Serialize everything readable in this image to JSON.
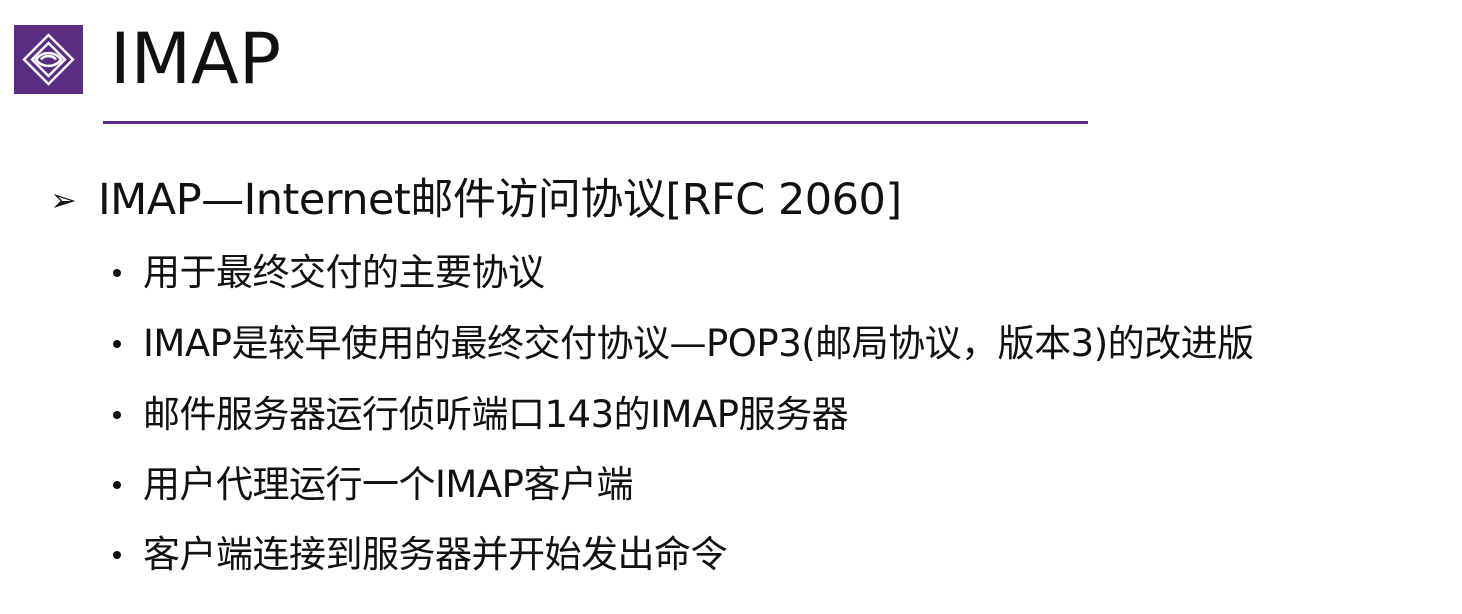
{
  "slide": {
    "title": "IMAP",
    "icon": "purple-emblem-icon",
    "accent_color": "#5b2d82",
    "main_bullet": "IMAP—Internet邮件访问协议[RFC 2060]",
    "sub_bullets": [
      "用于最终交付的主要协议",
      "IMAP是较早使用的最终交付协议—POP3(邮局协议，版本3)的改进版",
      "邮件服务器运行侦听端口143的IMAP服务器",
      "用户代理运行一个IMAP客户端",
      "客户端连接到服务器并开始发出命令"
    ]
  }
}
